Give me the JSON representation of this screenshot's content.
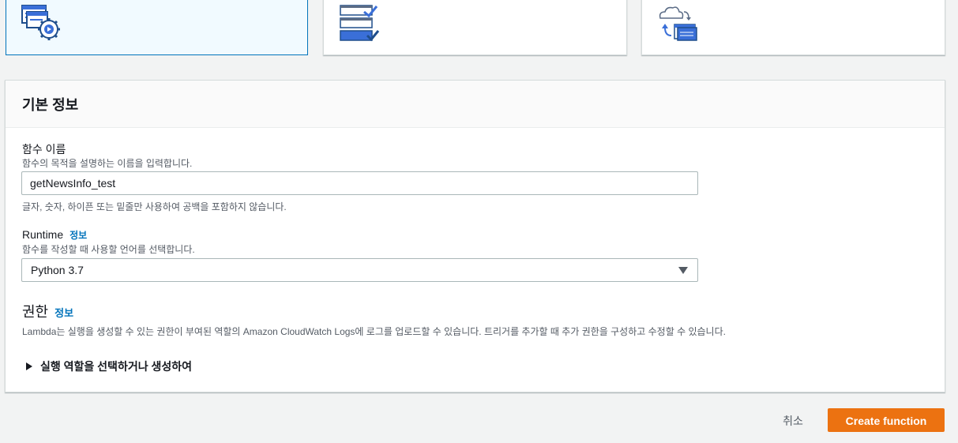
{
  "options": [
    {
      "icon": "author-from-scratch-icon",
      "selected": true
    },
    {
      "icon": "use-blueprint-icon",
      "selected": false
    },
    {
      "icon": "browse-serverless-repo-icon",
      "selected": false
    }
  ],
  "basic_info": {
    "title": "기본 정보",
    "function_name": {
      "label": "함수 이름",
      "description": "함수의 목적을 설명하는 이름을 입력합니다.",
      "value": "getNewsInfo_test",
      "hint": "글자, 숫자, 하이픈 또는 밑줄만 사용하여 공백을 포함하지 않습니다."
    },
    "runtime": {
      "label": "Runtime",
      "info_link": "정보",
      "description": "함수를 작성할 때 사용할 언어를 선택합니다.",
      "value": "Python 3.7"
    },
    "permissions": {
      "heading": "권한",
      "info_link": "정보",
      "description": "Lambda는 실행을 생성할 수 있는 권한이 부여된 역할의 Amazon CloudWatch Logs에 로그를 업로드할 수 있습니다. 트리거를 추가할 때 추가 권한을 구성하고 수정할 수 있습니다.",
      "expander_label": "실행 역할을 선택하거나 생성하여"
    }
  },
  "footer": {
    "cancel_label": "취소",
    "create_label": "Create function"
  },
  "colors": {
    "primary_button": "#ec7211",
    "link": "#0073bb",
    "selected_card_border": "#0073bb",
    "page_background": "#f2f3f3"
  }
}
